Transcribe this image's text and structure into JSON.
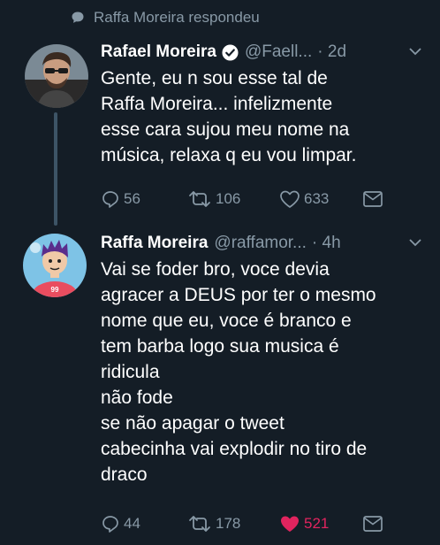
{
  "reply_context": {
    "text": "Raffa Moreira respondeu",
    "icon": "speech-bubble-icon"
  },
  "tweets": [
    {
      "name": "Rafael Moreira",
      "verified": true,
      "handle": "@Faell...",
      "time": "· 2d",
      "lines": [
        "Gente, eu n sou esse tal de",
        "Raffa Moreira... infelizmente",
        "esse cara sujou meu nome na",
        "música, relaxa q eu vou limpar."
      ],
      "actions": {
        "replies": "56",
        "retweets": "106",
        "likes": "633"
      }
    },
    {
      "name": "Raffa Moreira",
      "verified": false,
      "handle": "@raffamor...",
      "time": "· 4h",
      "lines": [
        "Vai se foder bro, voce devia",
        "agracer a DEUS por ter o mesmo",
        "nome que eu, voce é branco e",
        "tem barba logo sua musica é",
        "ridicula",
        "não fode",
        "se não apagar o tweet",
        "cabecinha vai explodir no tiro de",
        "draco"
      ],
      "actions": {
        "replies": "44",
        "retweets": "178",
        "likes": "521",
        "liked": true
      }
    }
  ],
  "colors": {
    "background": "#141d26",
    "secondary_text": "#8899a6",
    "like": "#e0245e",
    "verified": "#ffffff"
  }
}
